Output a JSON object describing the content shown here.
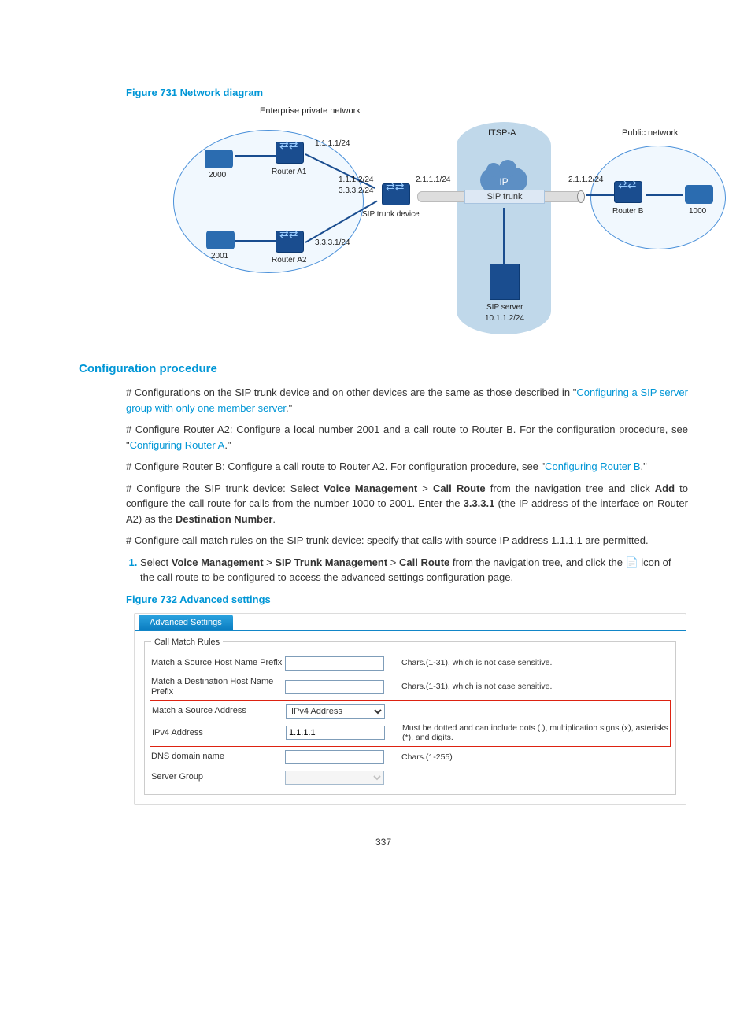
{
  "figure731": {
    "title": "Figure 731 Network diagram",
    "labels": {
      "enterprise": "Enterprise private network",
      "public": "Public network",
      "itsp": "ITSP-A",
      "ip": "IP",
      "sip_trunk": "SIP trunk",
      "sip_trunk_device": "SIP trunk device",
      "sip_server": "SIP server",
      "sip_server_ip": "10.1.1.2/24",
      "router_a1": "Router A1",
      "router_a2": "Router A2",
      "router_b": "Router B",
      "phone_2000": "2000",
      "phone_2001": "2001",
      "phone_1000": "1000",
      "ip_1_1_1_1": "1.1.1.1/24",
      "ip_1_1_1_2": "1.1.1.2/24",
      "ip_2_1_1_1": "2.1.1.1/24",
      "ip_2_1_1_2": "2.1.1.2/24",
      "ip_3_3_3_1": "3.3.3.1/24",
      "ip_3_3_3_2": "3.3.3.2/24"
    }
  },
  "section_title": "Configuration procedure",
  "para1": {
    "lead": "# Configurations on the SIP trunk device and on other devices are the same as those described in \"",
    "link": "Configuring a SIP server group with only one member server",
    "tail": ".\""
  },
  "para2": {
    "lead": "# Configure Router A2: Configure a local number 2001 and a call route to Router B. For the configuration procedure, see \"",
    "link": "Configuring Router A",
    "tail": ".\""
  },
  "para3": {
    "lead": "# Configure Router B: Configure a call route to Router A2. For configuration procedure, see \"",
    "link": "Configuring Router B",
    "tail": ".\""
  },
  "para4": {
    "pre": "# Configure the SIP trunk device: Select ",
    "b1": "Voice Management",
    "gt1": " > ",
    "b2": "Call Route",
    "mid1": " from the navigation tree and click ",
    "b3": "Add",
    "mid2": " to configure the call route for calls from the number 1000 to 2001. Enter the ",
    "b4": "3.3.3.1",
    "mid3": " (the IP address of the interface on Router A2) as the ",
    "b5": "Destination Number",
    "tail": "."
  },
  "para5": "# Configure call match rules on the SIP trunk device: specify that calls with source IP address 1.1.1.1 are permitted.",
  "step1": {
    "pre": "Select ",
    "b1": "Voice Management",
    "gt1": " > ",
    "b2": "SIP Trunk Management",
    "gt2": " > ",
    "b3": "Call Route",
    "mid": " from the navigation tree, and click the ",
    "tail": " icon of the call route to be configured to access the advanced settings configuration page."
  },
  "figure732": {
    "title": "Figure 732 Advanced settings",
    "tab": "Advanced Settings",
    "legend": "Call Match Rules",
    "rows": {
      "src_host": {
        "label": "Match a Source Host Name Prefix",
        "value": "",
        "help": "Chars.(1-31), which is not case sensitive."
      },
      "dst_host": {
        "label": "Match a Destination Host Name Prefix",
        "value": "",
        "help": "Chars.(1-31), which is not case sensitive."
      },
      "src_addr": {
        "label": "Match a Source Address",
        "selected": "IPv4 Address"
      },
      "ipv4": {
        "label": "IPv4 Address",
        "value": "1.1.1.1",
        "help": "Must be dotted and can include dots (.), multiplication signs (x), asterisks (*), and digits."
      },
      "dns": {
        "label": "DNS domain name",
        "value": "",
        "help": "Chars.(1-255)"
      },
      "server_group": {
        "label": "Server Group",
        "selected": ""
      }
    }
  },
  "page_number": "337"
}
